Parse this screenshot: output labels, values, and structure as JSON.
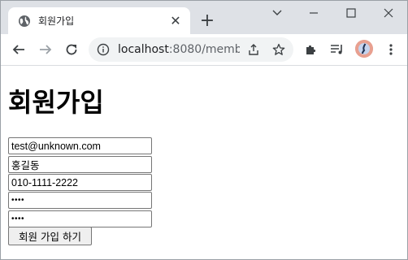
{
  "browser": {
    "tab": {
      "title": "회원가입",
      "favicon": "globe-icon",
      "close_glyph": "✕"
    },
    "new_tab_glyph": "+",
    "window_controls": [
      "chevron-down-icon",
      "minimize-icon",
      "maximize-icon",
      "close-icon"
    ],
    "toolbar": {
      "back": "back-arrow-icon",
      "forward": "forward-arrow-icon",
      "reload": "reload-icon",
      "url_host": "localhost",
      "url_rest": ":8080/memb...",
      "share": "share-icon",
      "star": "star-icon",
      "extensions": "puzzle-icon",
      "media": "media-queue-icon",
      "avatar": "avatar",
      "menu": "kebab-menu-icon"
    }
  },
  "page": {
    "title": "회원가입",
    "fields": {
      "email": "test@unknown.com",
      "name": "홍길동",
      "phone": "010-1111-2222",
      "password": "••••",
      "password_confirm": "••••"
    },
    "submit_label": "회원 가입 하기"
  },
  "colors": {
    "tabstrip_bg": "#dee1e6",
    "omnibox_bg": "#f1f3f4",
    "button_bg": "#efefef",
    "field_border": "#767676"
  }
}
